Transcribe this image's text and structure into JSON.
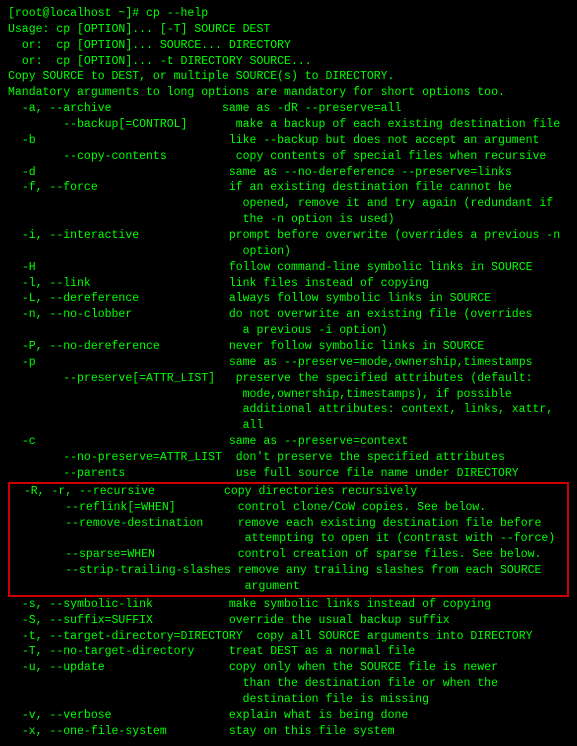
{
  "terminal": {
    "prompt": "[root@localhost ~]# cp --help",
    "lines": [
      {
        "text": "Usage: cp [OPTION]... [-T] SOURCE DEST",
        "highlight": false
      },
      {
        "text": "  or:  cp [OPTION]... SOURCE... DIRECTORY",
        "highlight": false
      },
      {
        "text": "  or:  cp [OPTION]... -t DIRECTORY SOURCE...",
        "highlight": false
      },
      {
        "text": "Copy SOURCE to DEST, or multiple SOURCE(s) to DIRECTORY.",
        "highlight": false
      },
      {
        "text": "",
        "highlight": false
      },
      {
        "text": "Mandatory arguments to long options are mandatory for short options too.",
        "highlight": false
      },
      {
        "text": "  -a, --archive                same as -dR --preserve=all",
        "highlight": false
      },
      {
        "text": "        --backup[=CONTROL]       make a backup of each existing destination file",
        "highlight": false
      },
      {
        "text": "  -b                            like --backup but does not accept an argument",
        "highlight": false
      },
      {
        "text": "        --copy-contents          copy contents of special files when recursive",
        "highlight": false
      },
      {
        "text": "  -d                            same as --no-dereference --preserve=links",
        "highlight": false
      },
      {
        "text": "  -f, --force                   if an existing destination file cannot be",
        "highlight": false
      },
      {
        "text": "                                  opened, remove it and try again (redundant if",
        "highlight": false
      },
      {
        "text": "                                  the -n option is used)",
        "highlight": false
      },
      {
        "text": "  -i, --interactive             prompt before overwrite (overrides a previous -n",
        "highlight": false
      },
      {
        "text": "                                  option)",
        "highlight": false
      },
      {
        "text": "  -H                            follow command-line symbolic links in SOURCE",
        "highlight": false
      },
      {
        "text": "  -l, --link                    link files instead of copying",
        "highlight": false
      },
      {
        "text": "  -L, --dereference             always follow symbolic links in SOURCE",
        "highlight": false
      },
      {
        "text": "  -n, --no-clobber              do not overwrite an existing file (overrides",
        "highlight": false
      },
      {
        "text": "                                  a previous -i option)",
        "highlight": false
      },
      {
        "text": "  -P, --no-dereference          never follow symbolic links in SOURCE",
        "highlight": false
      },
      {
        "text": "  -p                            same as --preserve=mode,ownership,timestamps",
        "highlight": false
      },
      {
        "text": "        --preserve[=ATTR_LIST]   preserve the specified attributes (default:",
        "highlight": false
      },
      {
        "text": "                                  mode,ownership,timestamps), if possible",
        "highlight": false
      },
      {
        "text": "                                  additional attributes: context, links, xattr,",
        "highlight": false
      },
      {
        "text": "                                  all",
        "highlight": false
      },
      {
        "text": "  -c                            same as --preserve=context",
        "highlight": false
      },
      {
        "text": "        --no-preserve=ATTR_LIST  don't preserve the specified attributes",
        "highlight": false
      },
      {
        "text": "        --parents                use full source file name under DIRECTORY",
        "highlight": false
      }
    ],
    "highlighted_lines": [
      {
        "text": "  -R, -r, --recursive          copy directories recursively"
      },
      {
        "text": "        --reflink[=WHEN]         control clone/CoW copies. See below."
      },
      {
        "text": "        --remove-destination     remove each existing destination file before"
      },
      {
        "text": "                                  attempting to open it (contrast with --force)"
      },
      {
        "text": "        --sparse=WHEN            control creation of sparse files. See below."
      },
      {
        "text": "        --strip-trailing-slashes remove any trailing slashes from each SOURCE"
      },
      {
        "text": "                                  argument"
      }
    ],
    "lines_after": [
      {
        "text": "  -s, --symbolic-link           make symbolic links instead of copying"
      },
      {
        "text": "  -S, --suffix=SUFFIX           override the usual backup suffix"
      },
      {
        "text": "  -t, --target-directory=DIRECTORY  copy all SOURCE arguments into DIRECTORY"
      },
      {
        "text": "  -T, --no-target-directory     treat DEST as a normal file"
      },
      {
        "text": "  -u, --update                  copy only when the SOURCE file is newer"
      },
      {
        "text": "                                  than the destination file or when the"
      },
      {
        "text": "                                  destination file is missing"
      },
      {
        "text": "  -v, --verbose                 explain what is being done"
      },
      {
        "text": "  -x, --one-file-system         stay on this file system"
      }
    ]
  }
}
